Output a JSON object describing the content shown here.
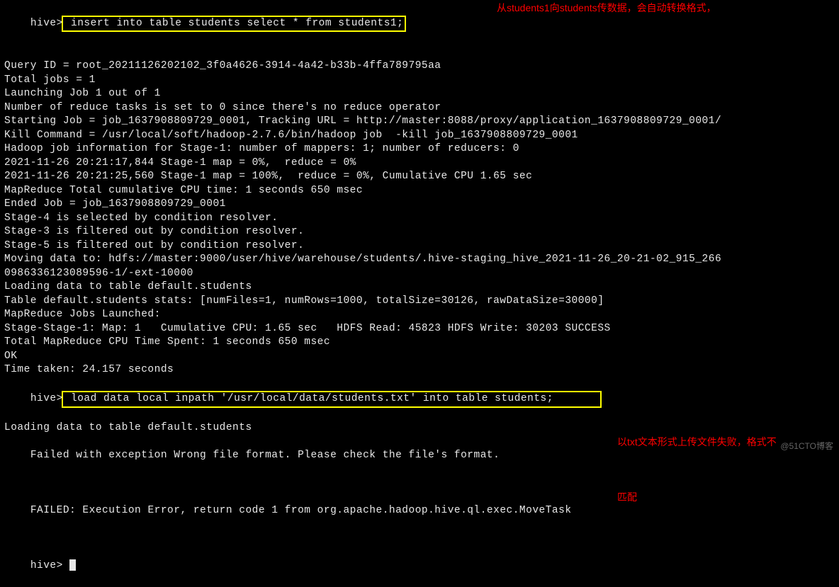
{
  "terminal": {
    "prompt": "hive>",
    "lines": [
      {
        "prefix": "hive>",
        "highlighted": " insert into table students select * from students1;"
      },
      "Query ID = root_20211126202102_3f0a4626-3914-4a42-b33b-4ffa789795aa",
      "Total jobs = 1",
      "Launching Job 1 out of 1",
      "Number of reduce tasks is set to 0 since there's no reduce operator",
      "Starting Job = job_1637908809729_0001, Tracking URL = http://master:8088/proxy/application_1637908809729_0001/",
      "Kill Command = /usr/local/soft/hadoop-2.7.6/bin/hadoop job  -kill job_1637908809729_0001",
      "Hadoop job information for Stage-1: number of mappers: 1; number of reducers: 0",
      "2021-11-26 20:21:17,844 Stage-1 map = 0%,  reduce = 0%",
      "2021-11-26 20:21:25,560 Stage-1 map = 100%,  reduce = 0%, Cumulative CPU 1.65 sec",
      "MapReduce Total cumulative CPU time: 1 seconds 650 msec",
      "Ended Job = job_1637908809729_0001",
      "Stage-4 is selected by condition resolver.",
      "Stage-3 is filtered out by condition resolver.",
      "Stage-5 is filtered out by condition resolver.",
      "Moving data to: hdfs://master:9000/user/hive/warehouse/students/.hive-staging_hive_2021-11-26_20-21-02_915_266",
      "0986336123089596-1/-ext-10000",
      "Loading data to table default.students",
      "Table default.students stats: [numFiles=1, numRows=1000, totalSize=30126, rawDataSize=30000]",
      "MapReduce Jobs Launched:",
      "Stage-Stage-1: Map: 1   Cumulative CPU: 1.65 sec   HDFS Read: 45823 HDFS Write: 30203 SUCCESS",
      "Total MapReduce CPU Time Spent: 1 seconds 650 msec",
      "OK",
      "Time taken: 24.157 seconds",
      {
        "prefix": "hive>",
        "highlighted": " load data local inpath '/usr/local/data/students.txt' into table students;       "
      },
      "Loading data to table default.students",
      "Failed with exception Wrong file format. Please check the file's format.",
      "FAILED: Execution Error, return code 1 from org.apache.hadoop.hive.ql.exec.MoveTask",
      {
        "prefix": "hive> ",
        "cursor": true
      }
    ]
  },
  "annotations": {
    "top": "从students1向students传数据，会自动转换格式，",
    "bottom1": "以txt文本形式上传文件失败，格式不",
    "bottom2": "匹配"
  },
  "watermark": "@51CTO博客"
}
